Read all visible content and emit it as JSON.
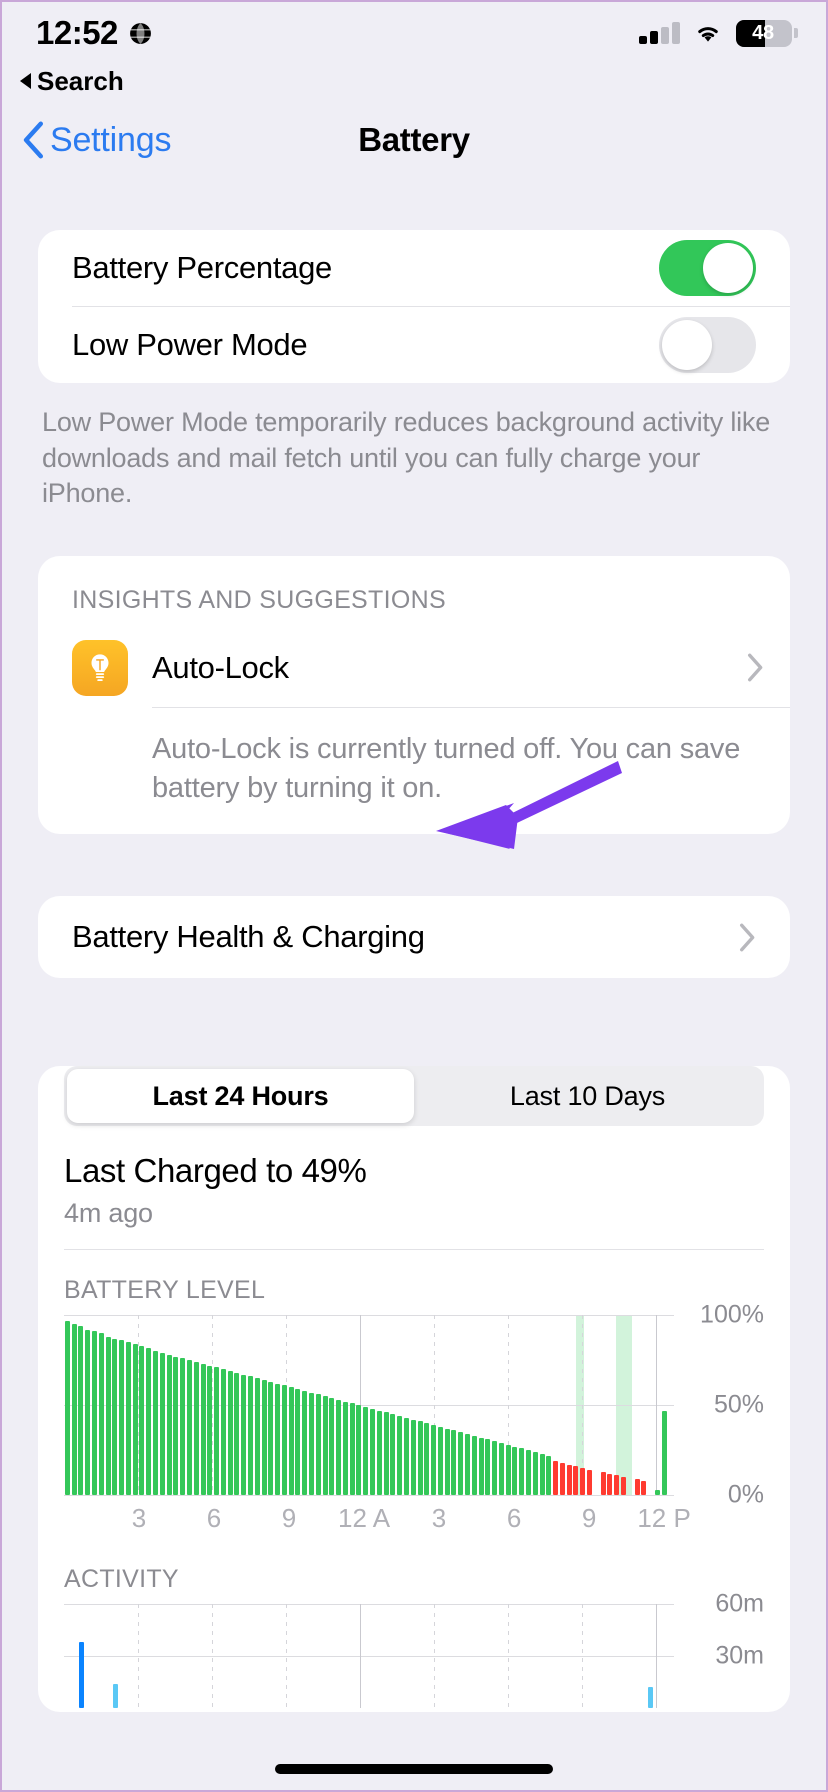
{
  "status_bar": {
    "time": "12:52",
    "location_icon": "globe-icon",
    "signal_icon": "cellular-signal-icon",
    "wifi_icon": "wifi-icon",
    "battery_percent": "48",
    "battery_fill_ratio": 0.52
  },
  "back_to_search": {
    "label": "Search",
    "icon": "back-triangle-icon"
  },
  "navbar": {
    "back_label": "Settings",
    "back_icon": "chevron-left-icon",
    "title": "Battery"
  },
  "settings": {
    "battery_percentage": {
      "label": "Battery Percentage",
      "enabled": true
    },
    "low_power_mode": {
      "label": "Low Power Mode",
      "enabled": false
    },
    "low_power_footnote": "Low Power Mode temporarily reduces background activity like downloads and mail fetch until you can fully charge your iPhone."
  },
  "insights": {
    "header": "INSIGHTS AND SUGGESTIONS",
    "item_label": "Auto-Lock",
    "item_icon": "lightbulb-icon",
    "chevron_icon": "chevron-right-icon",
    "description": "Auto-Lock is currently turned off. You can save battery by turning it on."
  },
  "battery_health": {
    "label": "Battery Health & Charging",
    "chevron_icon": "chevron-right-icon"
  },
  "annotation": {
    "name": "purple-arrow-annotation",
    "color": "#7c3aed"
  },
  "usage": {
    "segments": [
      {
        "label": "Last 24 Hours",
        "active": true
      },
      {
        "label": "Last 10 Days",
        "active": false
      }
    ],
    "last_charged_title": "Last Charged to 49%",
    "last_charged_sub": "4m ago"
  },
  "colors": {
    "green": "#34c759",
    "red": "#ff3b30",
    "blue": "#0a84ff",
    "light_blue": "#5ac8f5",
    "accent": "#2b7bf0",
    "purple": "#7c3aed",
    "page_bg": "#efeef5",
    "card_bg": "#ffffff",
    "secondary_text": "#8b8b91"
  },
  "chart_data": [
    {
      "type": "bar",
      "title": "BATTERY LEVEL",
      "xlabel": "",
      "ylabel": "",
      "ylim": [
        0,
        100
      ],
      "ytick_labels": [
        "100%",
        "50%",
        "0%"
      ],
      "ytick_values": [
        100,
        50,
        0
      ],
      "xtick_labels": [
        "3",
        "6",
        "9",
        "12 A",
        "3",
        "6",
        "9",
        "12 P"
      ],
      "grid": true,
      "legend": "none",
      "series": [
        {
          "name": "Battery level",
          "color": "#34c759",
          "values": [
            97,
            95,
            94,
            92,
            91,
            90,
            88,
            87,
            86,
            85,
            84,
            83,
            82,
            80,
            79,
            78,
            77,
            76,
            75,
            74,
            73,
            72,
            71,
            70,
            69,
            68,
            67,
            66,
            65,
            64,
            63,
            62,
            61,
            60,
            59,
            58,
            57,
            56,
            55,
            54,
            53,
            52,
            51,
            50,
            49,
            48,
            47,
            46,
            45,
            44,
            43,
            42,
            41,
            40,
            39,
            38,
            37,
            36,
            35,
            34,
            33,
            32,
            31,
            30,
            29,
            28,
            27,
            26,
            25,
            24,
            23,
            22,
            0,
            0,
            0,
            0,
            0,
            0,
            0,
            0,
            0,
            0,
            0,
            0,
            0,
            0,
            0,
            3,
            47,
            0
          ]
        },
        {
          "name": "Low battery (red)",
          "color": "#ff3b30",
          "values": [
            0,
            0,
            0,
            0,
            0,
            0,
            0,
            0,
            0,
            0,
            0,
            0,
            0,
            0,
            0,
            0,
            0,
            0,
            0,
            0,
            0,
            0,
            0,
            0,
            0,
            0,
            0,
            0,
            0,
            0,
            0,
            0,
            0,
            0,
            0,
            0,
            0,
            0,
            0,
            0,
            0,
            0,
            0,
            0,
            0,
            0,
            0,
            0,
            0,
            0,
            0,
            0,
            0,
            0,
            0,
            0,
            0,
            0,
            0,
            0,
            0,
            0,
            0,
            0,
            0,
            0,
            0,
            0,
            0,
            0,
            0,
            0,
            19,
            18,
            17,
            16,
            15,
            14,
            0,
            13,
            12,
            11,
            10,
            0,
            9,
            8,
            0,
            0,
            0
          ]
        }
      ],
      "charge_bands": [
        {
          "start_pct": 84.0,
          "width_pct": 1.2
        },
        {
          "start_pct": 90.5,
          "width_pct": 2.6
        }
      ]
    },
    {
      "type": "bar",
      "title": "ACTIVITY",
      "xlabel": "",
      "ylabel": "",
      "ylim": [
        0,
        60
      ],
      "ytick_labels": [
        "60m",
        "30m"
      ],
      "ytick_values": [
        60,
        30
      ],
      "grid": true,
      "legend": "none",
      "series": [
        {
          "name": "Screen on",
          "color": "#0a84ff",
          "values": [
            0,
            0,
            38,
            0,
            0,
            0,
            0,
            0,
            0,
            0,
            0,
            0,
            0,
            0,
            0,
            0,
            0,
            0,
            0,
            0,
            0,
            0,
            0,
            0,
            0,
            0,
            0,
            0,
            0,
            0,
            0,
            0,
            0,
            0,
            0,
            0,
            0,
            0,
            0,
            0,
            0,
            0,
            0,
            0,
            0,
            0,
            0,
            0,
            0,
            0,
            0,
            0,
            0,
            0,
            0,
            0,
            0,
            0,
            0,
            0,
            0,
            0,
            0,
            0,
            0,
            0,
            0,
            0,
            0,
            0,
            0,
            0,
            0,
            0,
            0,
            0,
            0,
            0,
            0,
            0,
            0,
            0,
            0,
            0,
            0,
            0,
            0,
            0,
            0
          ]
        },
        {
          "name": "Screen off",
          "color": "#5ac8f5",
          "values": [
            0,
            0,
            0,
            0,
            0,
            0,
            0,
            14,
            0,
            0,
            0,
            0,
            0,
            0,
            0,
            0,
            0,
            0,
            0,
            0,
            0,
            0,
            0,
            0,
            0,
            0,
            0,
            0,
            0,
            0,
            0,
            0,
            0,
            0,
            0,
            0,
            0,
            0,
            0,
            0,
            0,
            0,
            0,
            0,
            0,
            0,
            0,
            0,
            0,
            0,
            0,
            0,
            0,
            0,
            0,
            0,
            0,
            0,
            0,
            0,
            0,
            0,
            0,
            0,
            0,
            0,
            0,
            0,
            0,
            0,
            0,
            0,
            0,
            0,
            0,
            0,
            0,
            0,
            0,
            0,
            0,
            0,
            0,
            0,
            0,
            12,
            0,
            0,
            0
          ]
        }
      ]
    }
  ]
}
